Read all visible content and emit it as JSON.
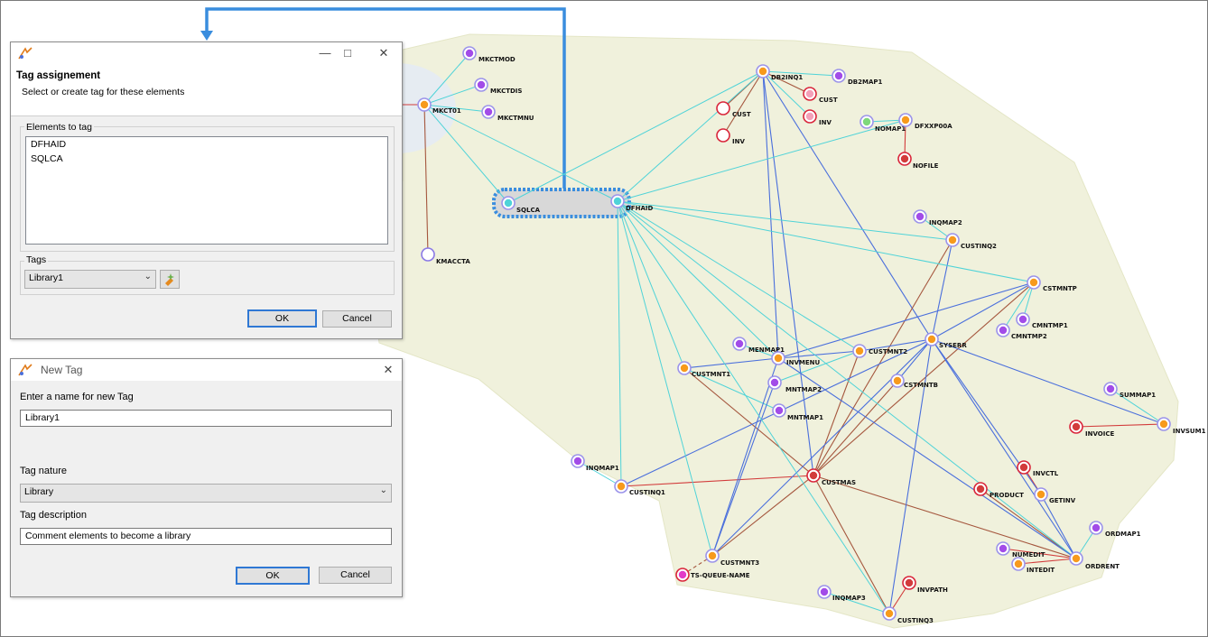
{
  "graph": {
    "nodes": [
      {
        "id": "MKCTMOD",
        "label": "MKCTMOD",
        "kind": "purple"
      },
      {
        "id": "MKCTDIS",
        "label": "MKCTDIS",
        "kind": "purple"
      },
      {
        "id": "MKCT01",
        "label": "MKCT01",
        "kind": "orange"
      },
      {
        "id": "MKCTMNU",
        "label": "MKCTMNU",
        "kind": "purple"
      },
      {
        "id": "KMACCTA",
        "label": "KMACCTA",
        "kind": "empty"
      },
      {
        "id": "SQLCA",
        "label": "SQLCA",
        "kind": "cyan"
      },
      {
        "id": "DFHAID",
        "label": "DFHAID",
        "kind": "cyan"
      },
      {
        "id": "DB2INQ1",
        "label": "DB2INQ1",
        "kind": "orange"
      },
      {
        "id": "DB2MAP1",
        "label": "DB2MAP1",
        "kind": "purple"
      },
      {
        "id": "CUST1",
        "label": "CUST",
        "kind": "pink"
      },
      {
        "id": "CUST2",
        "label": "CUST",
        "kind": "redring"
      },
      {
        "id": "INV1",
        "label": "INV",
        "kind": "pink"
      },
      {
        "id": "INV2",
        "label": "INV",
        "kind": "redring"
      },
      {
        "id": "NOMAP1",
        "label": "NOMAP1",
        "kind": "green"
      },
      {
        "id": "DFXXP00A",
        "label": "DFXXP00A",
        "kind": "orange"
      },
      {
        "id": "NOFILE",
        "label": "NOFILE",
        "kind": "red"
      },
      {
        "id": "INQMAP2",
        "label": "INQMAP2",
        "kind": "purple"
      },
      {
        "id": "CUSTINQ2",
        "label": "CUSTINQ2",
        "kind": "orange"
      },
      {
        "id": "CSTMNTP",
        "label": "CSTMNTP",
        "kind": "orange"
      },
      {
        "id": "CMNTMP1",
        "label": "CMNTMP1",
        "kind": "purple"
      },
      {
        "id": "CMNTMP2",
        "label": "CMNTMP2",
        "kind": "purple"
      },
      {
        "id": "SYSERR",
        "label": "SYSERR",
        "kind": "orange"
      },
      {
        "id": "MENMAP1",
        "label": "MENMAP1",
        "kind": "purple"
      },
      {
        "id": "INVMENU",
        "label": "INVMENU",
        "kind": "orange"
      },
      {
        "id": "CUSTMNT2",
        "label": "CUSTMNT2",
        "kind": "orange"
      },
      {
        "id": "CUSTMNT1",
        "label": "CUSTMNT1",
        "kind": "orange"
      },
      {
        "id": "MNTMAP2",
        "label": "MNTMAP2",
        "kind": "purple"
      },
      {
        "id": "CSTMNTB",
        "label": "CSTMNTB",
        "kind": "orange"
      },
      {
        "id": "MNTMAP1",
        "label": "MNTMAP1",
        "kind": "purple"
      },
      {
        "id": "SUMMAP1",
        "label": "SUMMAP1",
        "kind": "purple"
      },
      {
        "id": "INVOICE",
        "label": "INVOICE",
        "kind": "red"
      },
      {
        "id": "INVSUM1",
        "label": "INVSUM1",
        "kind": "orange"
      },
      {
        "id": "INQMAP1",
        "label": "INQMAP1",
        "kind": "purple"
      },
      {
        "id": "CUSTINQ1",
        "label": "CUSTINQ1",
        "kind": "orange"
      },
      {
        "id": "CUSTMAS",
        "label": "CUSTMAS",
        "kind": "red"
      },
      {
        "id": "INVCTL",
        "label": "INVCTL",
        "kind": "red"
      },
      {
        "id": "PRODUCT",
        "label": "PRODUCT",
        "kind": "red"
      },
      {
        "id": "GETINV",
        "label": "GETINV",
        "kind": "orange"
      },
      {
        "id": "ORDMAP1",
        "label": "ORDMAP1",
        "kind": "purple"
      },
      {
        "id": "NUMEDIT",
        "label": "NUMEDIT",
        "kind": "purple"
      },
      {
        "id": "INTEDIT",
        "label": "INTEDIT",
        "kind": "orange"
      },
      {
        "id": "ORDRENT",
        "label": "ORDRENT",
        "kind": "orange"
      },
      {
        "id": "CUSTMNT3",
        "label": "CUSTMNT3",
        "kind": "orange"
      },
      {
        "id": "TSQUEUE",
        "label": "TS-QUEUE-NAME",
        "kind": "magenta"
      },
      {
        "id": "INQMAP3",
        "label": "INQMAP3",
        "kind": "purple"
      },
      {
        "id": "INVPATH",
        "label": "INVPATH",
        "kind": "red"
      },
      {
        "id": "CUSTINQ3",
        "label": "CUSTINQ3",
        "kind": "orange"
      }
    ],
    "edges": [
      [
        "MKCT01",
        "MKCTMOD",
        "cyan"
      ],
      [
        "MKCT01",
        "MKCTDIS",
        "cyan"
      ],
      [
        "MKCT01",
        "MKCTMNU",
        "cyan"
      ],
      [
        "MKCT01",
        "KMACCTA",
        "brown"
      ],
      [
        "MKCT01",
        "SQLCA",
        "cyan"
      ],
      [
        "MKCT01",
        "DFHAID",
        "cyan"
      ],
      [
        "MKCT01",
        "LEFT",
        "red"
      ],
      [
        "DB2INQ1",
        "DB2MAP1",
        "cyan"
      ],
      [
        "DB2INQ1",
        "CUST1",
        "brown"
      ],
      [
        "DB2INQ1",
        "CUST2",
        "brown"
      ],
      [
        "DB2INQ1",
        "INV1",
        "cyan"
      ],
      [
        "DB2INQ1",
        "INV2",
        "brown"
      ],
      [
        "DB2INQ1",
        "SQLCA",
        "cyan"
      ],
      [
        "DB2INQ1",
        "DFHAID",
        "cyan"
      ],
      [
        "DB2INQ1",
        "INVMENU",
        "blue"
      ],
      [
        "DB2INQ1",
        "SYSERR",
        "blue"
      ],
      [
        "DB2INQ1",
        "CUSTMAS",
        "blue"
      ],
      [
        "DFXXP00A",
        "NOMAP1",
        "cyan"
      ],
      [
        "DFXXP00A",
        "NOFILE",
        "red"
      ],
      [
        "DFXXP00A",
        "DFHAID",
        "cyan"
      ],
      [
        "CUSTINQ2",
        "INQMAP2",
        "cyan"
      ],
      [
        "CUSTINQ2",
        "DFHAID",
        "cyan"
      ],
      [
        "CUSTINQ2",
        "SYSERR",
        "blue"
      ],
      [
        "CUSTINQ2",
        "CUSTMAS",
        "brown"
      ],
      [
        "CSTMNTP",
        "CMNTMP1",
        "cyan"
      ],
      [
        "CSTMNTP",
        "CMNTMP2",
        "cyan"
      ],
      [
        "CSTMNTP",
        "SYSERR",
        "blue"
      ],
      [
        "CSTMNTP",
        "INVMENU",
        "blue"
      ],
      [
        "CSTMNTP",
        "DFHAID",
        "cyan"
      ],
      [
        "CSTMNTP",
        "CUSTMAS",
        "brown"
      ],
      [
        "CUSTMNT2",
        "SYSERR",
        "blue"
      ],
      [
        "CUSTMNT2",
        "INVMENU",
        "blue"
      ],
      [
        "CUSTMNT2",
        "MNTMAP2",
        "cyan"
      ],
      [
        "CUSTMNT2",
        "DFHAID",
        "cyan"
      ],
      [
        "CUSTMNT2",
        "CUSTMAS",
        "brown"
      ],
      [
        "CSTMNTB",
        "SYSERR",
        "blue"
      ],
      [
        "CSTMNTB",
        "CUSTMAS",
        "brown"
      ],
      [
        "CUSTMNT1",
        "INVMENU",
        "blue"
      ],
      [
        "CUSTMNT1",
        "MNTMAP1",
        "cyan"
      ],
      [
        "CUSTMNT1",
        "DFHAID",
        "cyan"
      ],
      [
        "CUSTMNT1",
        "CUSTMAS",
        "brown"
      ],
      [
        "INVMENU",
        "MENMAP1",
        "cyan"
      ],
      [
        "INVMENU",
        "DFHAID",
        "cyan"
      ],
      [
        "INVSUM1",
        "SUMMAP1",
        "cyan"
      ],
      [
        "INVSUM1",
        "INVOICE",
        "red"
      ],
      [
        "INVSUM1",
        "SYSERR",
        "blue"
      ],
      [
        "CUSTINQ1",
        "INQMAP1",
        "cyan"
      ],
      [
        "CUSTINQ1",
        "DFHAID",
        "cyan"
      ],
      [
        "CUSTINQ1",
        "CUSTMAS",
        "red"
      ],
      [
        "CUSTINQ1",
        "SYSERR",
        "blue"
      ],
      [
        "GETINV",
        "INVCTL",
        "red"
      ],
      [
        "GETINV",
        "SYSERR",
        "blue"
      ],
      [
        "ORDRENT",
        "ORDMAP1",
        "cyan"
      ],
      [
        "ORDRENT",
        "NUMEDIT",
        "red"
      ],
      [
        "ORDRENT",
        "INTEDIT",
        "red"
      ],
      [
        "ORDRENT",
        "PRODUCT",
        "brown"
      ],
      [
        "ORDRENT",
        "CUSTMAS",
        "brown"
      ],
      [
        "ORDRENT",
        "SYSERR",
        "blue"
      ],
      [
        "ORDRENT",
        "GETINV",
        "blue"
      ],
      [
        "ORDRENT",
        "DFHAID",
        "cyan"
      ],
      [
        "ORDRENT",
        "INVMENU",
        "blue"
      ],
      [
        "CUSTMNT3",
        "TSQUEUE",
        "brown"
      ],
      [
        "CUSTMNT3",
        "INVMENU",
        "blue"
      ],
      [
        "CUSTMNT3",
        "MNTMAP2",
        "blue"
      ],
      [
        "CUSTMNT3",
        "DFHAID",
        "cyan"
      ],
      [
        "CUSTMNT3",
        "CUSTMAS",
        "brown"
      ],
      [
        "CUSTMNT3",
        "SYSERR",
        "blue"
      ],
      [
        "CUSTINQ3",
        "INQMAP3",
        "cyan"
      ],
      [
        "CUSTINQ3",
        "INVPATH",
        "red"
      ],
      [
        "CUSTINQ3",
        "CUSTMAS",
        "brown"
      ],
      [
        "CUSTINQ3",
        "SYSERR",
        "blue"
      ],
      [
        "CUSTINQ3",
        "DFHAID",
        "cyan"
      ]
    ]
  },
  "colors": {
    "hull": "#f0f1dc",
    "hull_stroke": "#e4e6c6",
    "cyan": "#4fd3d8",
    "blue": "#4a6fdc",
    "brown": "#a5573e",
    "red": "#d23b3b",
    "accent": "#3a8dde",
    "orange": "#f79a1c",
    "purple": "#a24ce8",
    "ring": "#9b93ea",
    "pink": "#f4a0b8",
    "green": "#7ed87a",
    "magenta": "#e23ac8"
  },
  "tag_dialog": {
    "title": "",
    "heading": "Tag assignement",
    "subtitle": "Select or create tag for these elements",
    "elements_group_label": "Elements to tag",
    "elements": [
      "DFHAID",
      "SQLCA"
    ],
    "tags_group_label": "Tags",
    "tags_selected": "Library1",
    "ok_label": "OK",
    "cancel_label": "Cancel"
  },
  "new_tag_dialog": {
    "title": "New Tag",
    "name_label": "Enter a name for new Tag",
    "name_value": "Library1",
    "nature_label": "Tag nature",
    "nature_value": "Library",
    "description_label": "Tag description",
    "description_value": "Comment elements to become a library",
    "ok_label": "OK",
    "cancel_label": "Cancel"
  }
}
